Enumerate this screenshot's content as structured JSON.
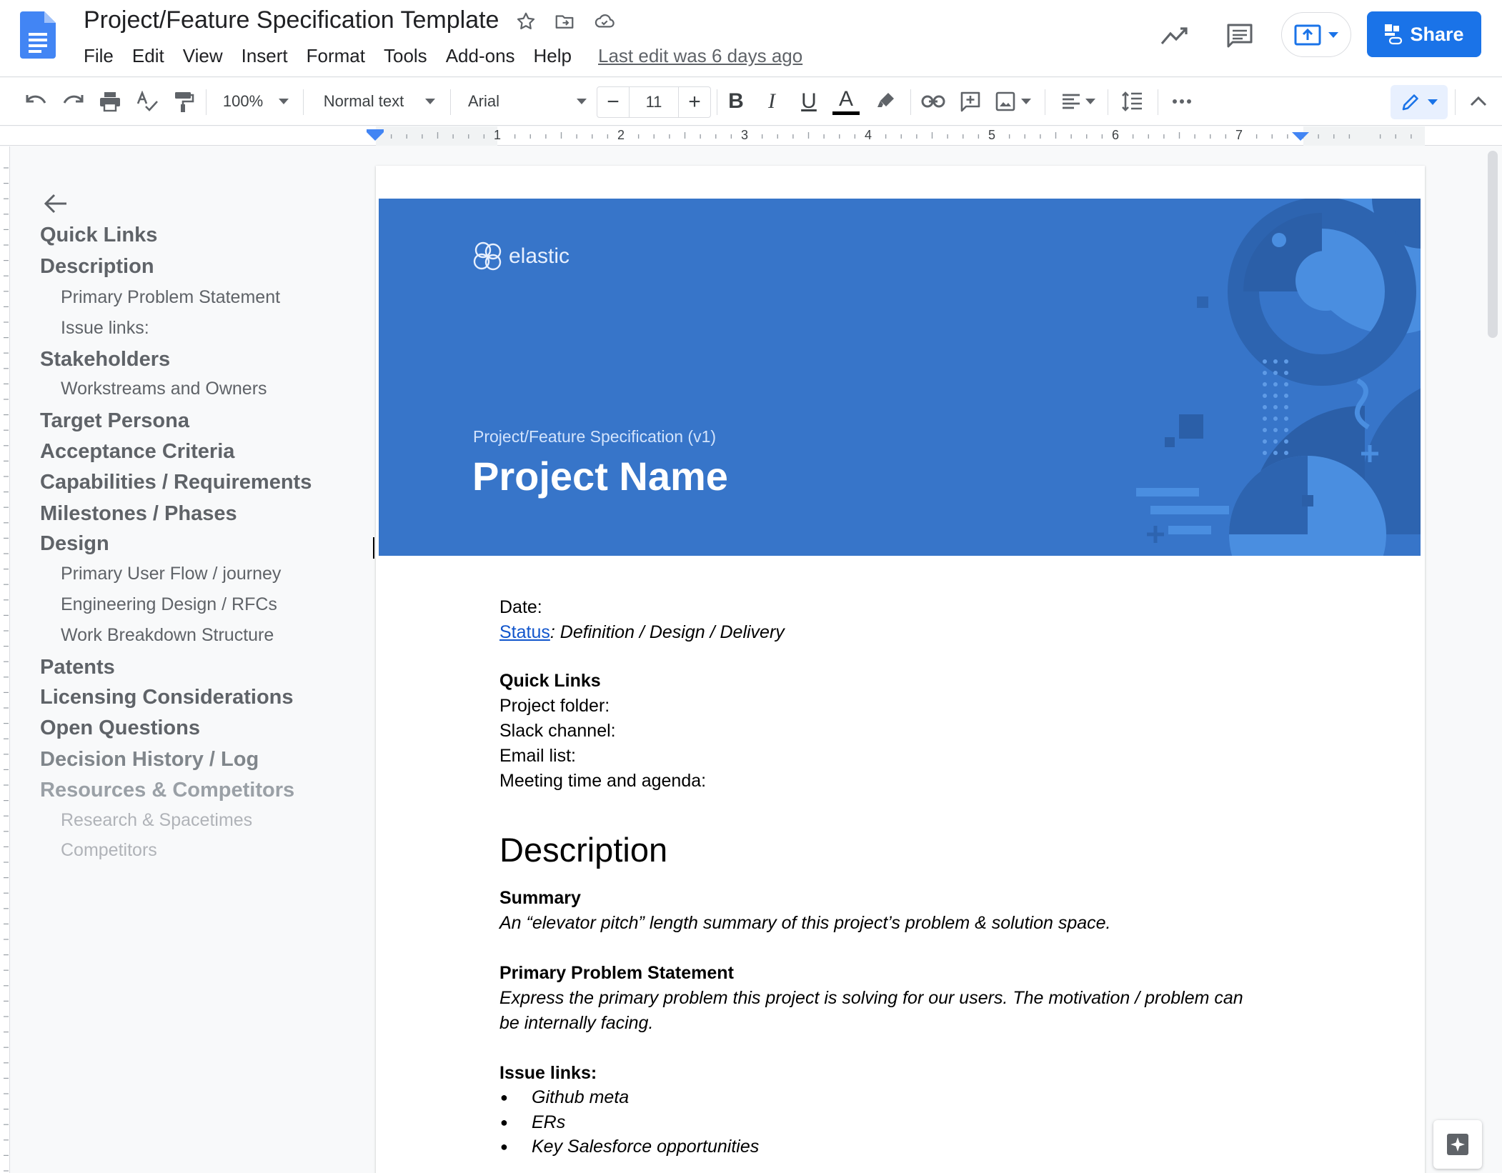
{
  "header": {
    "doc_title": "Project/Feature Specification Template",
    "menu": [
      "File",
      "Edit",
      "View",
      "Insert",
      "Format",
      "Tools",
      "Add-ons",
      "Help"
    ],
    "last_edit": "Last edit was 6 days ago",
    "share_label": "Share"
  },
  "toolbar": {
    "zoom": "100%",
    "style": "Normal text",
    "font": "Arial",
    "font_size": "11",
    "bold_label": "B",
    "italic_label": "I",
    "underline_label": "U",
    "text_color_label": "A"
  },
  "ruler": {
    "numbers": [
      "1",
      "2",
      "3",
      "4",
      "5",
      "6",
      "7"
    ]
  },
  "outline": {
    "items": [
      {
        "label": "Quick Links",
        "level": 1
      },
      {
        "label": "Description",
        "level": 1
      },
      {
        "label": "Primary Problem Statement",
        "level": 2
      },
      {
        "label": "Issue links:",
        "level": 2
      },
      {
        "label": "Stakeholders",
        "level": 1
      },
      {
        "label": "Workstreams and Owners",
        "level": 2
      },
      {
        "label": "Target Persona",
        "level": 1
      },
      {
        "label": "Acceptance Criteria",
        "level": 1
      },
      {
        "label": "Capabilities / Requirements",
        "level": 1
      },
      {
        "label": "Milestones / Phases",
        "level": 1
      },
      {
        "label": "Design",
        "level": 1
      },
      {
        "label": "Primary User Flow / journey",
        "level": 2
      },
      {
        "label": "Engineering Design / RFCs",
        "level": 2
      },
      {
        "label": "Work Breakdown Structure",
        "level": 2
      },
      {
        "label": "Patents",
        "level": 1
      },
      {
        "label": "Licensing Considerations",
        "level": 1
      },
      {
        "label": "Open Questions",
        "level": 1
      },
      {
        "label": "Decision History / Log",
        "level": 1
      },
      {
        "label": "Resources & Competitors",
        "level": 1
      },
      {
        "label": "Research & Spacetimes",
        "level": 2
      },
      {
        "label": "Competitors",
        "level": 2
      }
    ]
  },
  "document": {
    "banner_logo": "elastic",
    "banner_subtitle": "Project/Feature Specification (v1)",
    "banner_title": "Project Name",
    "date_label": "Date:",
    "status_link": "Status",
    "status_values": ": Definition / Design / Delivery",
    "quick_links_heading": "Quick Links",
    "quick_links": [
      "Project folder:",
      "Slack channel:",
      "Email list:",
      "Meeting time and agenda:"
    ],
    "description_heading": "Description",
    "summary_heading": "Summary",
    "summary_text": "An “elevator pitch” length summary of this project’s problem & solution space.",
    "problem_heading": "Primary Problem Statement",
    "problem_text_1": "Express the primary problem this project is solving for our users. The motivation / problem can",
    "problem_text_2": "be internally facing.",
    "issue_heading": "Issue links:",
    "issue_bullets": [
      "Github meta",
      "ERs",
      "Key Salesforce opportunities"
    ]
  },
  "colors": {
    "brand_blue": "#1a73e8",
    "banner_blue": "#3775c9",
    "link": "#1155cc"
  }
}
